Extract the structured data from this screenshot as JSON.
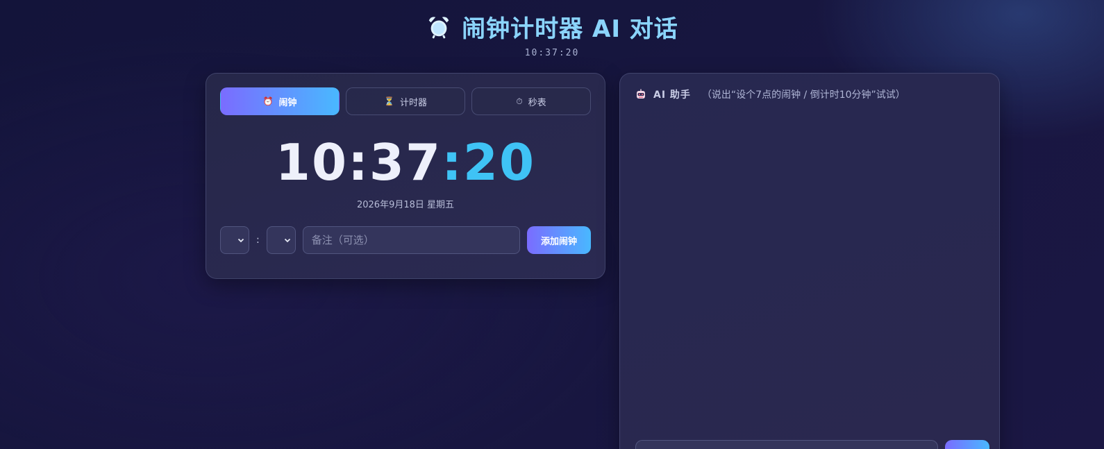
{
  "header": {
    "title": "闹钟计时器 AI 对话",
    "icon": "alarm-clock-icon",
    "current_time": "10:37:20"
  },
  "tabs": [
    {
      "label": "闹钟",
      "icon": "alarm-clock-icon",
      "active": true
    },
    {
      "label": "计时器",
      "icon": "hourglass-icon",
      "active": false
    },
    {
      "label": "秒表",
      "icon": "stopwatch-icon",
      "active": false
    }
  ],
  "clock": {
    "hours_minutes": "10:37",
    "seconds": ":20",
    "date": "2026年9月18日 星期五"
  },
  "alarm_form": {
    "hour_value": "",
    "minute_value": "",
    "separator": ":",
    "note_placeholder": "备注（可选）",
    "add_label": "添加闹钟"
  },
  "chat": {
    "icon": "robot-icon",
    "title": "AI 助手",
    "hint": "（说出“设个7点的闹钟 / 倒计时10分钟”试试）",
    "input_value": "",
    "send_label": ""
  },
  "colors": {
    "accent_gradient_start": "#7a6cff",
    "accent_gradient_end": "#49b8ff",
    "title_color": "#8bd4fb",
    "seconds_color": "#3fc3f5",
    "background": "#15153d",
    "panel": "#2a2a50"
  }
}
